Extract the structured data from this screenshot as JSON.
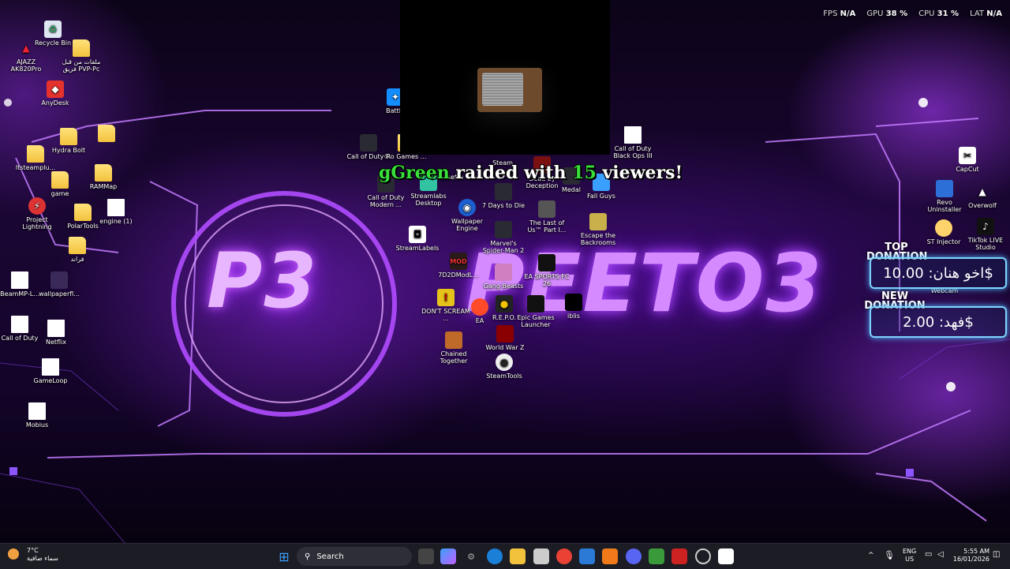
{
  "stats": {
    "fps_label": "FPS",
    "fps_value": "N/A",
    "gpu_label": "GPU",
    "gpu_value": "38 %",
    "cpu_label": "CPU",
    "cpu_value": "31 %",
    "lat_label": "LAT",
    "lat_value": "N/A"
  },
  "wallpaper": {
    "logo": "P3",
    "name": "PEETO3"
  },
  "raid": {
    "user": "gGreen",
    "middle": " raided with ",
    "count": "15",
    "suffix": " viewers!"
  },
  "donations": {
    "top_label": "TOP DONATION",
    "top_text": "اخو هنان: 10.00$",
    "new_label": "NEW DONATION",
    "new_text": "فهد: 2.00$"
  },
  "desktop_icons": [
    {
      "label": "Recycle Bin"
    },
    {
      "label": "AJAZZ AK820Pro"
    },
    {
      "label": "ملفات من قبل فريق PVP-Pc"
    },
    {
      "label": "AnyDesk"
    },
    {
      "label": "Hydra Bolt"
    },
    {
      "label": "Itsteamplu..."
    },
    {
      "label": "game"
    },
    {
      "label": "RAMMap"
    },
    {
      "label": "Project Lightning"
    },
    {
      "label": "PolarTools"
    },
    {
      "label": "engine (1)"
    },
    {
      "label": "قراند"
    },
    {
      "label": "BeamMP-L..."
    },
    {
      "label": "wallpaperfl..."
    },
    {
      "label": "Call of Duty"
    },
    {
      "label": "Netflix"
    },
    {
      "label": "GameLoop"
    },
    {
      "label": "Mobius"
    },
    {
      "label": "Battle"
    },
    {
      "label": "Call of Duty®"
    },
    {
      "label": "Ro Games ..."
    },
    {
      "label": "Call of Duty Modern ..."
    },
    {
      "label": "Streamlabs Desktop"
    },
    {
      "label": "StreamLabels"
    },
    {
      "label": "Assetto Corsa"
    },
    {
      "label": "Steam"
    },
    {
      "label": "Dead by Deception"
    },
    {
      "label": "Medal"
    },
    {
      "label": "Fall Guys"
    },
    {
      "label": "Wallpaper Engine"
    },
    {
      "label": "7 Days to Die"
    },
    {
      "label": "The Last of Us™ Part I..."
    },
    {
      "label": "Escape the Backrooms"
    },
    {
      "label": "Marvel's Spider-Man 2"
    },
    {
      "label": "7D2DModL..."
    },
    {
      "label": "Gang Beasts"
    },
    {
      "label": "EA SPORTS FC 26"
    },
    {
      "label": "DON'T SCREAM ..."
    },
    {
      "label": "EA"
    },
    {
      "label": "R.E.P.O."
    },
    {
      "label": "Epic Games Launcher"
    },
    {
      "label": "iblis"
    },
    {
      "label": "Chained Together"
    },
    {
      "label": "World War Z"
    },
    {
      "label": "SteamTools"
    },
    {
      "label": "Call of Duty Black Ops III"
    },
    {
      "label": "CapCut"
    },
    {
      "label": "Revo Uninstaller"
    },
    {
      "label": "Overwolf"
    },
    {
      "label": "ST Injector"
    },
    {
      "label": "TikTok LIVE Studio"
    },
    {
      "label": "Webcam"
    }
  ],
  "taskbar": {
    "weather_temp": "7°C",
    "weather_desc": "سماء صافية",
    "search_placeholder": "Search",
    "lang_top": "ENG",
    "lang_bottom": "US",
    "time": "5:55 AM",
    "date": "16/01/2026"
  }
}
